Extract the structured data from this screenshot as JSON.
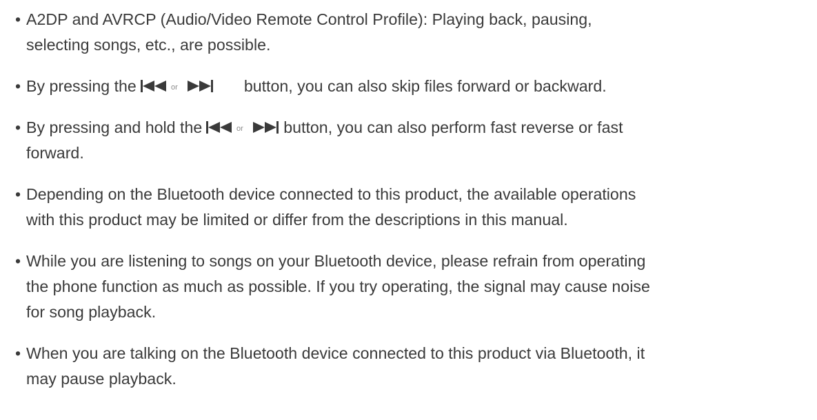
{
  "bullet_char": "•",
  "items": [
    {
      "lines": [
        "A2DP and AVRCP (Audio/Video Remote Control Profile): Playing back, pausing,",
        "selecting songs, etc., are possible."
      ]
    },
    {
      "before": "By pressing the",
      "icon_or": "or",
      "after": "button, you can also skip files forward or backward."
    },
    {
      "before": "By pressing and hold the",
      "icon_or": "or",
      "after": "button, you can also perform fast reverse or fast",
      "cont": "forward."
    },
    {
      "lines": [
        "Depending on the Bluetooth device connected to this product, the available operations",
        "with this product may be limited or differ from the descriptions in this manual."
      ]
    },
    {
      "lines": [
        "While you are listening to songs on your Bluetooth device, please refrain from operating",
        "the phone function as much as possible. If you try operating, the signal may cause noise",
        "for song playback."
      ]
    },
    {
      "lines": [
        "When you are talking on the Bluetooth device connected to this product via Bluetooth, it",
        "may pause playback."
      ]
    }
  ]
}
